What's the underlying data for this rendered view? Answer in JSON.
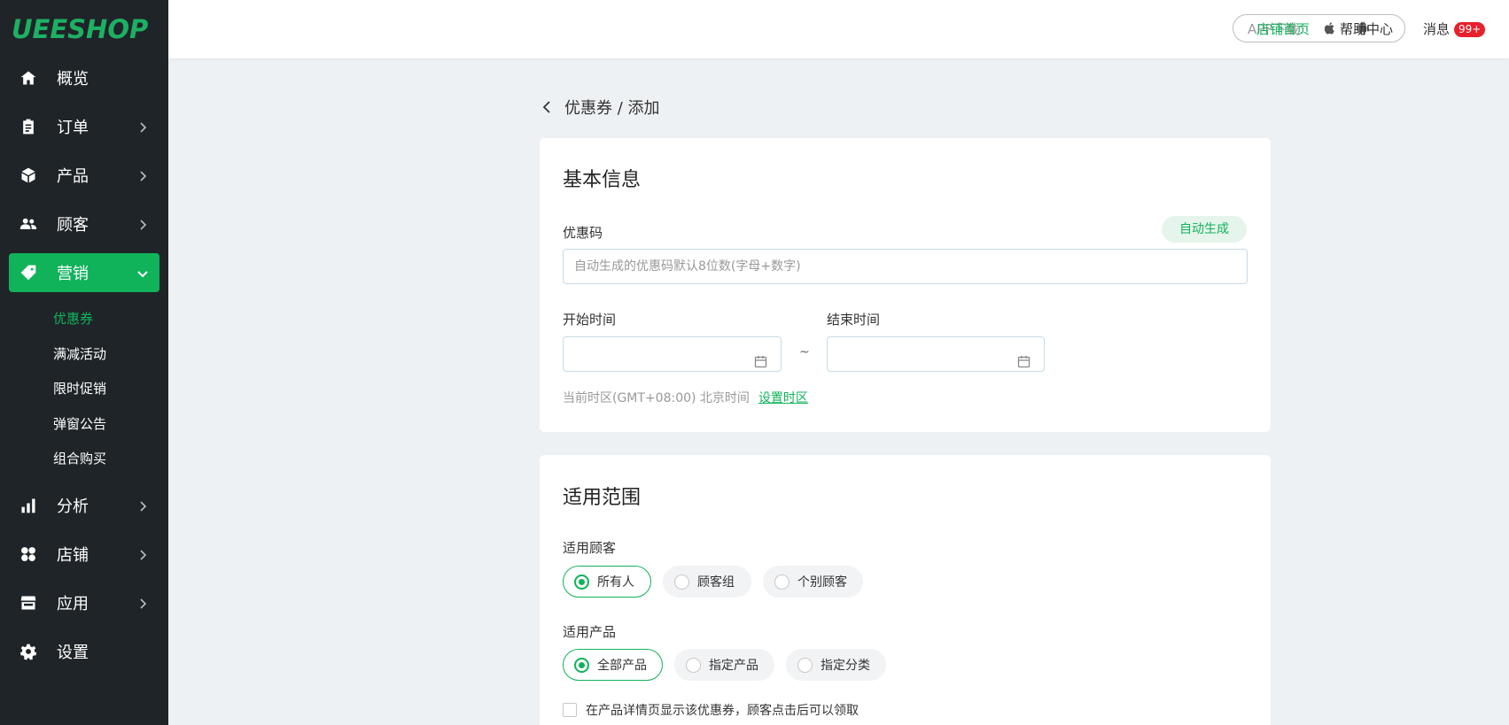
{
  "brand": {
    "logo_text": "UEESHOP",
    "accent": "#10b35a"
  },
  "sidebar": {
    "items": [
      {
        "label": "概览",
        "icon": "home-icon"
      },
      {
        "label": "订单",
        "icon": "clipboard-icon"
      },
      {
        "label": "产品",
        "icon": "box-icon"
      },
      {
        "label": "顾客",
        "icon": "users-icon"
      },
      {
        "label": "营销",
        "icon": "tag-icon",
        "active": true
      },
      {
        "label": "分析",
        "icon": "bar-chart-icon"
      },
      {
        "label": "店铺",
        "icon": "grid-icon"
      },
      {
        "label": "应用",
        "icon": "store-icon"
      },
      {
        "label": "设置",
        "icon": "gear-icon"
      }
    ],
    "marketing_sub": [
      "优惠券",
      "满减活动",
      "限时促销",
      "弹窗公告",
      "组合购买"
    ]
  },
  "topbar": {
    "app_download_label": "APP下载:",
    "slash": "/",
    "store_home": "店铺首页",
    "help_center": "帮助中心",
    "messages": "消息",
    "messages_badge": "99+"
  },
  "breadcrumb": {
    "text": "优惠券 / 添加"
  },
  "basic_info": {
    "title": "基本信息",
    "code_label": "优惠码",
    "auto_generate": "自动生成",
    "code_placeholder": "自动生成的优惠码默认8位数(字母+数字)",
    "start_label": "开始时间",
    "end_label": "结束时间",
    "tilde": "~",
    "timezone_text": "当前时区(GMT+08:00) 北京时间",
    "timezone_link": "设置时区"
  },
  "scope": {
    "title": "适用范围",
    "customer_label": "适用顾客",
    "customer_options": [
      "所有人",
      "顾客组",
      "个别顾客"
    ],
    "product_label": "适用产品",
    "product_options": [
      "全部产品",
      "指定产品",
      "指定分类"
    ],
    "show_on_detail": "在产品详情页显示该优惠券，顾客点击后可以领取"
  }
}
